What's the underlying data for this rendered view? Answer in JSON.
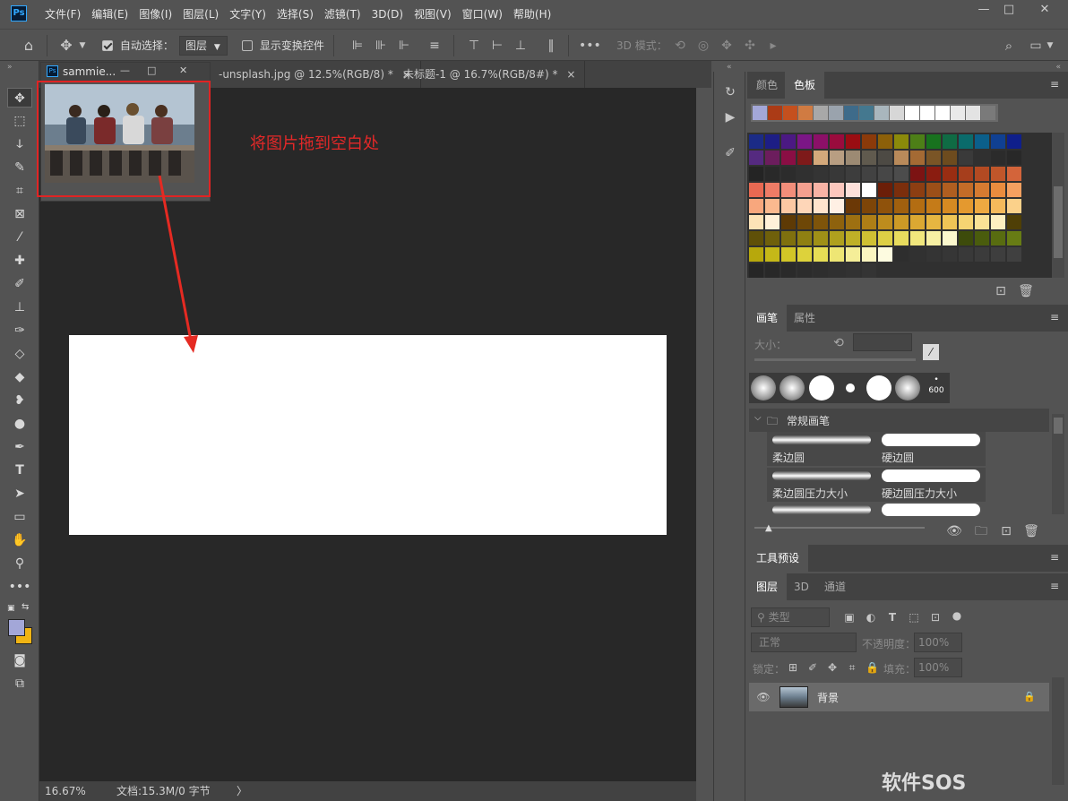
{
  "app": {
    "logo": "Ps",
    "menu": [
      "文件(F)",
      "编辑(E)",
      "图像(I)",
      "图层(L)",
      "文字(Y)",
      "选择(S)",
      "滤镜(T)",
      "3D(D)",
      "视图(V)",
      "窗口(W)",
      "帮助(H)"
    ],
    "window_controls": [
      "—",
      "□",
      "✕"
    ]
  },
  "options": {
    "auto_select_label": "自动选择：",
    "auto_select_checked": true,
    "auto_select_target": "图层",
    "show_transform_label": "显示变换控件",
    "show_transform_checked": false,
    "more": "•••",
    "mode3d_label": "3D 模式："
  },
  "tabs": [
    {
      "label": "-unsplash.jpg @ 12.5%(RGB/8) *",
      "close": "×"
    },
    {
      "label": "未标题-1 @ 16.7%(RGB/8#) *",
      "close": "×"
    }
  ],
  "float_window": {
    "title": "sammie...",
    "controls": [
      "—",
      "□",
      "✕"
    ]
  },
  "annotation": {
    "instruction": "将图片拖到空白处",
    "highlight_color": "#e02424"
  },
  "status": {
    "zoom": "16.67%",
    "doc": "文档:15.3M/0 字节",
    "arrow": "〉"
  },
  "swatches_panel": {
    "tabs": [
      "颜色",
      "色板"
    ],
    "active_tab": "色板",
    "recent": [
      "#a3a7d8",
      "#ab3b16",
      "#c5501e",
      "#d07b42",
      "#a8a8a8",
      "#9aa3ad",
      "#3e6b8a",
      "#44788f",
      "#a9b6bd",
      "#d7d7d7",
      "#ffffff",
      "#ffffff",
      "#ffffff",
      "#eaeaea",
      "#e3e3e3",
      "#7a7a7a"
    ],
    "grid": [
      [
        "#1b2b86",
        "#1d1e85",
        "#4b1983",
        "#7b1686",
        "#8c1068",
        "#9a0b3d",
        "#9a0d12",
        "#8b3a0a",
        "#8c6009",
        "#8b8a0a",
        "#4d7f17",
        "#18721e",
        "#0f6b44",
        "#0a6b6b",
        "#0b5f8b",
        "#104092",
        "#0f1f8b"
      ],
      [
        "#552a80",
        "#6c1d5d",
        "#8a0e44",
        "#7e1a1a",
        "#d4a97b",
        "#b89e82",
        "#9c8a73",
        "#605a4e",
        "#4d4a44",
        "#b98a5a",
        "#a46a34",
        "#7a5526",
        "#6d4b1e",
        "#3a3a3a",
        "#303030",
        "#2b2b2b",
        "#282828"
      ],
      [
        "#242424",
        "#292929",
        "#2c2c2c",
        "#303030",
        "#343434",
        "#383838",
        "#3d3d3d",
        "#424242",
        "#474747",
        "#4c4c4c",
        "#7c1313",
        "#8a1c10",
        "#992d12",
        "#a63e1c",
        "#b34a22",
        "#c0562a",
        "#d3643a"
      ],
      [
        "#e86952",
        "#ef7c66",
        "#f28e7a",
        "#f5a08f",
        "#f8b3a5",
        "#fbc7bd",
        "#fde0da",
        "#ffffff",
        "#6b1e08",
        "#7b2e0c",
        "#8c3e12",
        "#9c4f18",
        "#b05e20",
        "#c36c28",
        "#d67b31",
        "#e98c3e",
        "#f4a060"
      ],
      [
        "#f8a77d",
        "#fab98f",
        "#fcc8a3",
        "#fed6b8",
        "#ffe3cd",
        "#fff0e4",
        "#6b3806",
        "#7d4508",
        "#8f520b",
        "#a1600e",
        "#b36d12",
        "#c57b18",
        "#d68a22",
        "#e4992f",
        "#eea941",
        "#f5b95b",
        "#fbd18a"
      ],
      [
        "#fde3b7",
        "#fff1d9",
        "#5e3a05",
        "#6e4707",
        "#7e540a",
        "#8e620d",
        "#9e7011",
        "#ae7e16",
        "#be8c1d",
        "#cd9a26",
        "#dba832",
        "#e6b641",
        "#efc556",
        "#f6d472",
        "#fae296",
        "#fdefc0",
        "#4f3f06"
      ],
      [
        "#5f5008",
        "#6f600b",
        "#7f700e",
        "#8f8012",
        "#9f9017",
        "#afa01e",
        "#bfb027",
        "#cfc033",
        "#ddcf45",
        "#e8dc5e",
        "#f1e77d",
        "#f7f0a3",
        "#fcf8cd",
        "#3d4b0b",
        "#4a5c0d",
        "#586c10",
        "#677c14"
      ],
      [
        "#b7a80c",
        "#c5b818",
        "#d2c627",
        "#ddd23b",
        "#e6dd55",
        "#eee674",
        "#f5ee98",
        "#faf5bf",
        "#fdfbe0",
        "#2e2e2e",
        "#313131",
        "#343434",
        "#363636",
        "#393939",
        "#3b3b3b",
        "#3e3e3e",
        "#404040"
      ],
      [
        "#262626",
        "#282828",
        "#2a2a2a",
        "#2c2c2c",
        "#2e2e2e",
        "#303030",
        "#323232",
        "#343434"
      ]
    ]
  },
  "brush_panel": {
    "tabs": [
      "画笔",
      "属性"
    ],
    "size_label": "大小：",
    "preset_size": "600",
    "group": "常规画笔",
    "brushes": [
      "柔边圆",
      "硬边圆",
      "柔边圆压力大小",
      "硬边圆压力大小"
    ]
  },
  "tool_presets": {
    "tab": "工具预设"
  },
  "layers_panel": {
    "tabs": [
      "图层",
      "3D",
      "通道"
    ],
    "filter_label": "类型",
    "blend_mode": "正常",
    "opacity_label": "不透明度：",
    "opacity_value": "100%",
    "lock_label": "锁定：",
    "fill_label": "填充：",
    "fill_value": "100%",
    "layers": [
      {
        "name": "背景",
        "visible": true,
        "locked": true
      }
    ]
  },
  "watermark": "软件SOS"
}
